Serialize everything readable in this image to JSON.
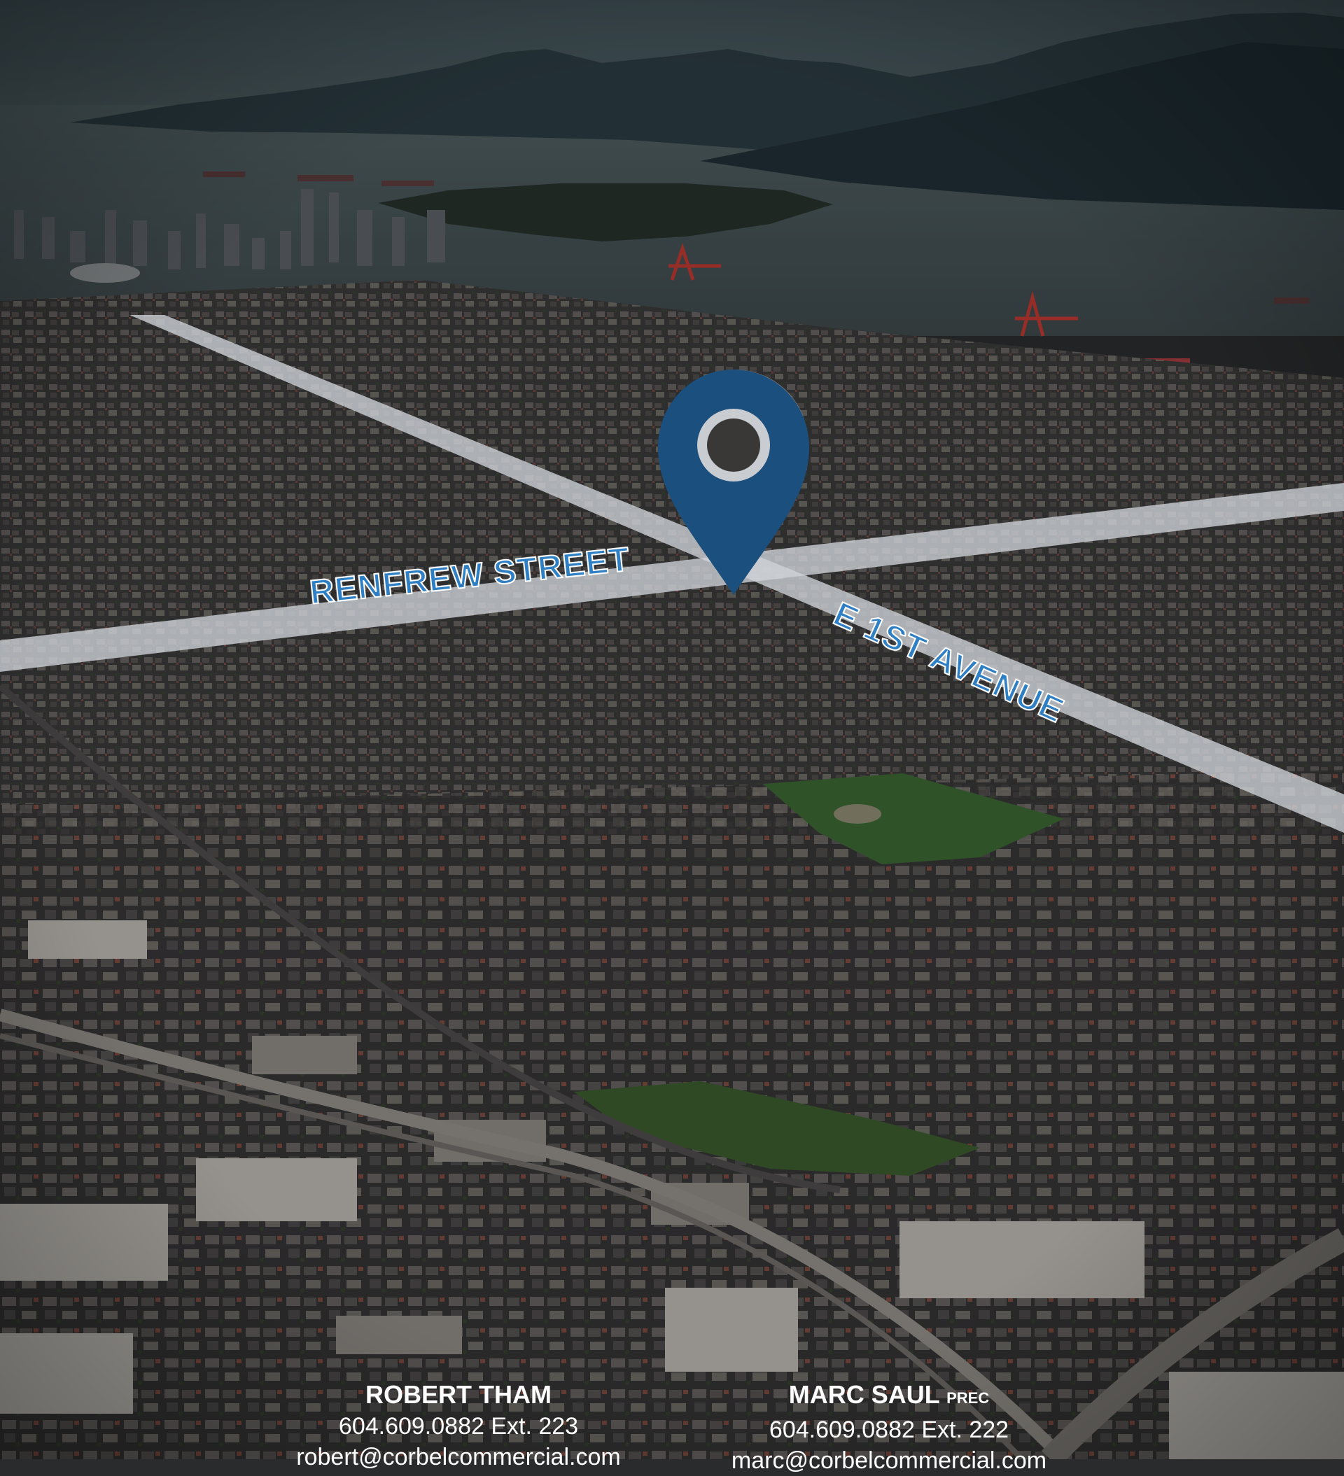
{
  "map": {
    "streets": [
      {
        "label": "RENFREW STREET"
      },
      {
        "label": "E 1ST AVENUE"
      }
    ],
    "pin_color": "#1b4f7e",
    "road_color": "#cfd3d8",
    "label_color": "#2f7fc4"
  },
  "contacts": [
    {
      "name": "ROBERT THAM",
      "suffix": "",
      "phone": "604.609.0882 Ext. 223",
      "email": "robert@corbelcommercial.com"
    },
    {
      "name": "MARC SAUL",
      "suffix": "PREC",
      "phone": "604.609.0882 Ext. 222",
      "email": "marc@corbelcommercial.com"
    }
  ]
}
